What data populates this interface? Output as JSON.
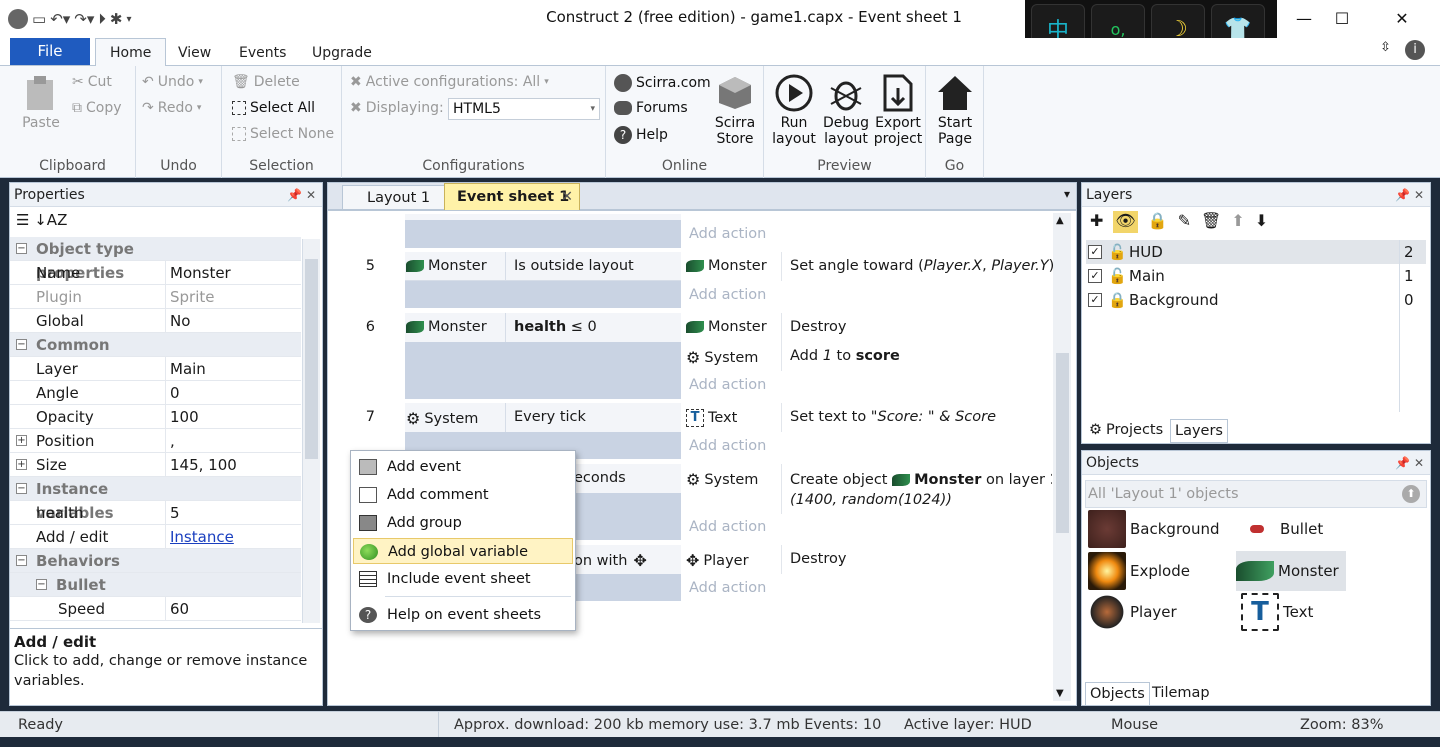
{
  "window": {
    "title": "Construct 2  (free edition) - game1.capx - Event sheet 1"
  },
  "ime": {
    "keys": [
      "中",
      "o,",
      "☽",
      "👕"
    ]
  },
  "ribbon_tabs": {
    "file": "File",
    "home": "Home",
    "view": "View",
    "events": "Events",
    "upgrade": "Upgrade"
  },
  "clipboard": {
    "paste": "Paste",
    "cut": "Cut",
    "copy": "Copy",
    "label": "Clipboard"
  },
  "undo": {
    "undo": "Undo",
    "redo": "Redo",
    "label": "Undo"
  },
  "selection": {
    "delete": "Delete",
    "select_all": "Select All",
    "select_none": "Select None",
    "label": "Selection"
  },
  "configurations": {
    "active": "Active configurations: All",
    "displaying": "Displaying:",
    "displaying_value": "HTML5",
    "label": "Configurations"
  },
  "online": {
    "scirra": "Scirra.com",
    "forums": "Forums",
    "help": "Help",
    "store_1": "Scirra",
    "store_2": "Store",
    "label": "Online"
  },
  "preview": {
    "run_1": "Run",
    "run_2": "layout",
    "debug_1": "Debug",
    "debug_2": "layout",
    "export_1": "Export",
    "export_2": "project",
    "label": "Preview"
  },
  "go": {
    "start_1": "Start",
    "start_2": "Page",
    "label": "Go"
  },
  "properties": {
    "title": "Properties",
    "rows": [
      {
        "k": "Object type properties",
        "cat": true
      },
      {
        "k": "Name",
        "v": "Monster"
      },
      {
        "k": "Plugin",
        "v": "Sprite",
        "dim": true
      },
      {
        "k": "Global",
        "v": "No"
      },
      {
        "k": "Common",
        "cat": true
      },
      {
        "k": "Layer",
        "v": "Main"
      },
      {
        "k": "Angle",
        "v": "0"
      },
      {
        "k": "Opacity",
        "v": "100"
      },
      {
        "k": "Position",
        "v": ","
      },
      {
        "k": "Size",
        "v": "145, 100"
      },
      {
        "k": "Instance variables",
        "cat": true
      },
      {
        "k": "health",
        "v": "5"
      },
      {
        "k": "Add / edit",
        "v": "Instance variables"
      },
      {
        "k": "Behaviors",
        "cat": true
      },
      {
        "k": "Bullet",
        "cat": true
      },
      {
        "k": "Speed",
        "v": "60"
      }
    ],
    "help_title": "Add / edit",
    "help_text": "Click to add, change or remove instance variables."
  },
  "doc_tabs": {
    "layout": "Layout 1",
    "sheet": "Event sheet 1"
  },
  "events": {
    "add_action": "Add action",
    "e5": {
      "num": "5",
      "obj": "Monster",
      "cond": "Is outside layout",
      "aobj": "Monster",
      "act_pre": "Set angle toward (",
      "act_it": "Player.X",
      "act_mid": ", ",
      "act_it2": "Player.Y",
      "act_post": ")"
    },
    "e6": {
      "num": "6",
      "obj": "Monster",
      "cond_b": "health",
      "cond_r": " ≤ 0",
      "aobj1": "Monster",
      "act1": "Destroy",
      "aobj2": "System",
      "act2_pre": "Add ",
      "act2_it": "1",
      "act2_mid": " to ",
      "act2_b": "score"
    },
    "e7": {
      "num": "7",
      "obj": "System",
      "cond": "Every tick",
      "aobj": "Text",
      "act_pre": "Set text to \"",
      "act_it": "Score: \" & Score"
    },
    "e8": {
      "cond_tail": "econds",
      "aobj": "System",
      "act_pre": "Create object ",
      "act_b": "Monster",
      "act_mid": " on layer ",
      "act_b2": "1",
      "act_tail": " a",
      "act_line2": "(1400, random(1024))"
    },
    "e9": {
      "cond_tail": "on with",
      "aobj": "Player",
      "act": "Destroy"
    }
  },
  "context_menu": {
    "items": [
      "Add event",
      "Add comment",
      "Add group",
      "Add global variable",
      "Include event sheet",
      "Help on event sheets"
    ]
  },
  "layers": {
    "title": "Layers",
    "rows": [
      {
        "name": "HUD",
        "n": "2"
      },
      {
        "name": "Main",
        "n": "1"
      },
      {
        "name": "Background",
        "n": "0"
      }
    ],
    "tab_projects": "Projects",
    "tab_layers": "Layers"
  },
  "objects": {
    "title": "Objects",
    "filter": "All 'Layout 1' objects",
    "items": [
      "Background",
      "Bullet",
      "Explode",
      "Monster",
      "Player",
      "Text"
    ],
    "tab_objects": "Objects",
    "tab_tilemap": "Tilemap"
  },
  "status": {
    "ready": "Ready",
    "download": "Approx. download: 200 kb  memory use: 3.7 mb  Events: 10",
    "layer": "Active layer: HUD",
    "mouse": "Mouse",
    "zoom": "Zoom: 83%"
  },
  "colors": {
    "file_tab": "#1f5bbf",
    "accent_tab": "#fff2a8",
    "event_bg": "#c9d3e3"
  }
}
